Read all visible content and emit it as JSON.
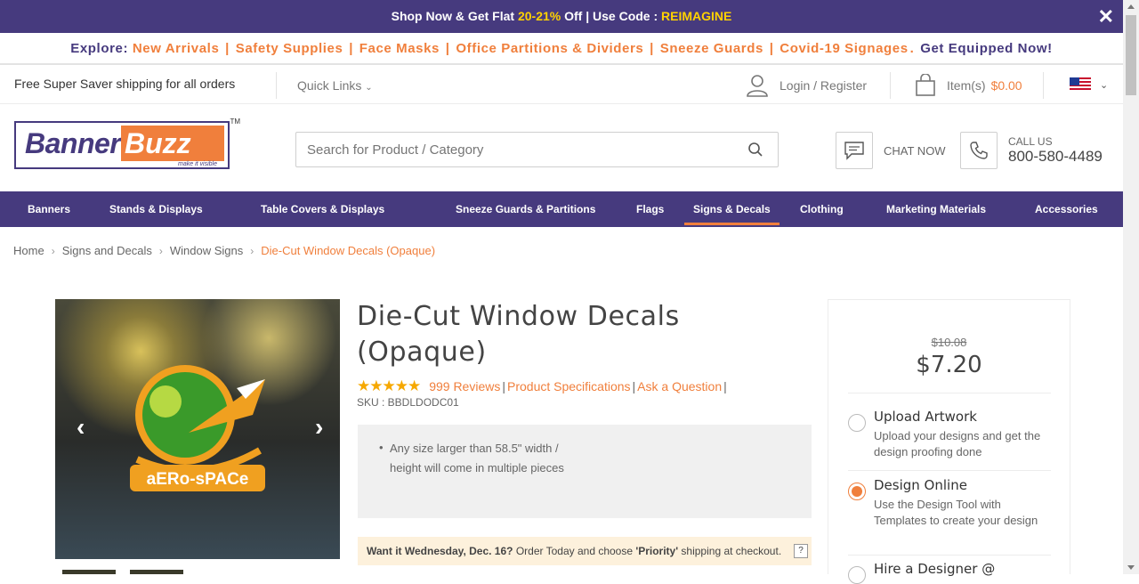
{
  "promo": {
    "prefix": "Shop Now & Get Flat ",
    "highlight": "20-21%",
    "middle": " Off | Use Code : ",
    "code": "REIMAGINE",
    "close": "✕"
  },
  "explore": {
    "label": "Explore:",
    "links": [
      "New Arrivals",
      "Safety Supplies",
      "Face Masks",
      "Office Partitions & Dividers",
      "Sneeze Guards",
      "Covid-19 Signages"
    ],
    "cta": "Get Equipped Now!"
  },
  "utility": {
    "shipping": "Free Super Saver shipping for all orders",
    "quick_links": "Quick Links",
    "login": "Login / Register",
    "cart_label": "Item(s)",
    "cart_amount": "$0.00"
  },
  "header": {
    "logo_part1": "Banner",
    "logo_part2": "Buzz",
    "logo_tagline": "make it visible",
    "logo_tm": "TM",
    "search_placeholder": "Search for Product / Category",
    "chat": "CHAT NOW",
    "call_label": "CALL US",
    "call_number": "800-580-4489"
  },
  "nav": [
    "Banners",
    "Stands & Displays",
    "Table Covers & Displays",
    "Sneeze Guards & Partitions",
    "Flags",
    "Signs & Decals",
    "Clothing",
    "Marketing Materials",
    "Accessories"
  ],
  "breadcrumb": [
    "Home",
    "Signs and Decals",
    "Window Signs",
    "Die-Cut Window Decals (Opaque)"
  ],
  "product": {
    "title_line1": "Die-Cut Window Decals",
    "title_line2": "(Opaque)",
    "rating_stars": "★★★★★",
    "rating": 4.5,
    "reviews": "999 Reviews",
    "specs": "Product Specifications",
    "ask": "Ask a Question",
    "sku": "SKU : BBDLDODC01",
    "note": "Any size larger than 58.5\" width / height will come in multiple pieces",
    "delivery_bold": "Want it Wednesday, Dec. 16?",
    "delivery_text": " Order Today and choose ",
    "delivery_priority": "'Priority'",
    "delivery_tail": " shipping at checkout.",
    "delivery_help": "?",
    "image_text": "aERo-sPACe"
  },
  "pricing": {
    "old_price": "$10.08",
    "new_price": "$7.20",
    "options": [
      {
        "title": "Upload Artwork",
        "desc": "Upload your designs and get the design proofing done",
        "selected": false
      },
      {
        "title": "Design Online",
        "desc": "Use the Design Tool with Templates to create your design",
        "selected": true
      },
      {
        "title": "Hire a Designer @",
        "desc": "",
        "selected": false
      }
    ]
  },
  "colors": {
    "brand_purple": "#463a7e",
    "accent_orange": "#f07f3c",
    "promo_yellow": "#ffd200"
  }
}
